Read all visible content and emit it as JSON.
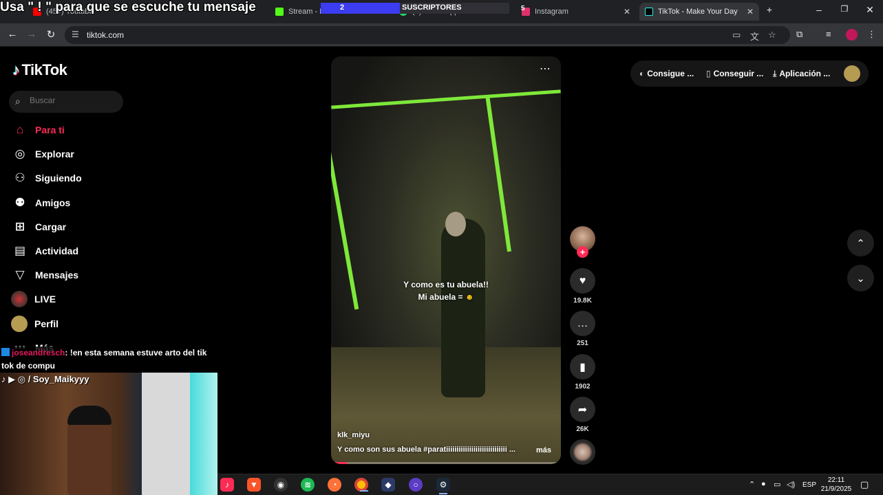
{
  "overlay": {
    "stream_message": "Usa \" ! \" para que se escuche tu mensaje",
    "sub_goal_count": "2",
    "sub_goal_label": "SUSCRIPTORES",
    "sub_goal_progress": 0.42
  },
  "browser": {
    "tabs": [
      {
        "label": "(457) Youtube",
        "icon_color": "#ff0000",
        "active": false
      },
      {
        "label": "Stream - Kick Dashboard",
        "icon_color": "#53fc18",
        "active": false
      },
      {
        "label": "(1) WhatsApp",
        "icon_color": "#25d366",
        "active": false
      },
      {
        "label": "Instagram",
        "icon_color": "#e1306c",
        "active": false
      },
      {
        "label": "TikTok - Make Your Day",
        "icon_color": "#000000",
        "active": true
      }
    ],
    "tab_badge": "5",
    "new_tab": "+",
    "url": "tiktok.com"
  },
  "tiktok": {
    "logo_text": "TikTok",
    "search_placeholder": "Buscar",
    "nav": [
      {
        "label": "Para ti",
        "icon": "home-icon",
        "active": true
      },
      {
        "label": "Explorar",
        "icon": "compass-icon",
        "active": false
      },
      {
        "label": "Siguiendo",
        "icon": "following-icon",
        "active": false
      },
      {
        "label": "Amigos",
        "icon": "friends-icon",
        "active": false
      },
      {
        "label": "Cargar",
        "icon": "upload-icon",
        "active": false
      },
      {
        "label": "Actividad",
        "icon": "activity-icon",
        "active": false
      },
      {
        "label": "Mensajes",
        "icon": "messages-icon",
        "active": false
      },
      {
        "label": "LIVE",
        "icon": "live-avatar",
        "active": false
      },
      {
        "label": "Perfil",
        "icon": "profile-avatar",
        "active": false
      },
      {
        "label": "Más",
        "icon": "more-icon",
        "active": false
      }
    ],
    "header": {
      "item1": "Consigue ...",
      "item2": "Conseguir ...",
      "item3": "Aplicación ..."
    },
    "video": {
      "caption_line1": "Y como es tu abuela!!",
      "caption_line2": "Mi abuela =",
      "author": "klk_miyu",
      "description": "Y como son sus abuela #paratiiiiiiiiiiiiiiiiiiiiiiiiiiiii ...",
      "more": "más",
      "progress": 0.07
    },
    "actions": {
      "likes": "19.8K",
      "comments": "251",
      "saves": "1902",
      "shares": "26K"
    }
  },
  "chat": {
    "user": "joseandresch",
    "message": ": !en esta semana estuve arto del tik tok de compu"
  },
  "webcam": {
    "handle": "/ Soy_Maikyyy"
  },
  "taskbar": {
    "language": "ESP",
    "time": "22:11",
    "date": "21/9/2025"
  }
}
